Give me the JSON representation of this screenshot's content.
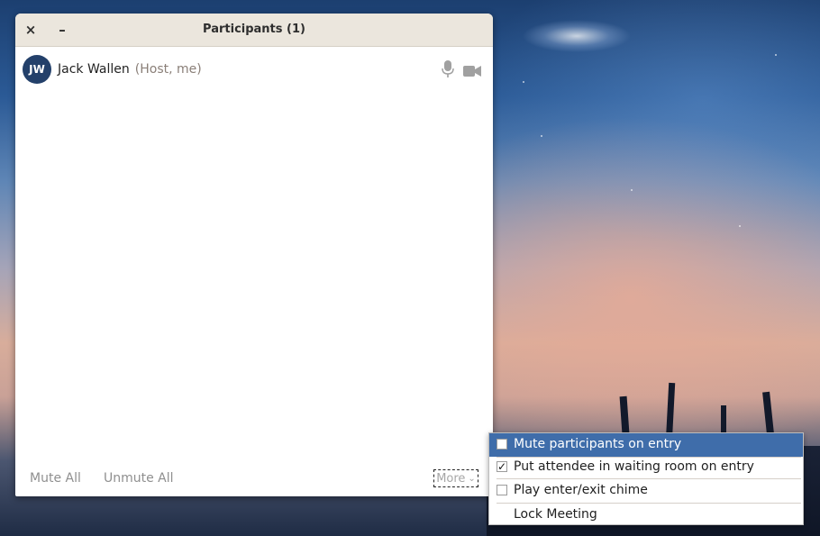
{
  "window": {
    "title": "Participants (1)",
    "close_glyph": "×",
    "minimize_glyph": "–"
  },
  "participant": {
    "initials": "JW",
    "name": "Jack Wallen",
    "role": "(Host, me)",
    "mic_icon": "microphone-icon",
    "camera_icon": "video-camera-icon"
  },
  "footer": {
    "mute_all": "Mute All",
    "unmute_all": "Unmute All",
    "more": "More",
    "more_chevron": "⌄"
  },
  "menu": {
    "items": [
      {
        "label": "Mute participants on entry",
        "checked": false,
        "highlighted": true,
        "check_glyph": ""
      },
      {
        "label": "Put attendee in waiting room on entry",
        "checked": true,
        "highlighted": false,
        "check_glyph": "✓"
      },
      {
        "label": "Play enter/exit chime",
        "checked": false,
        "highlighted": false,
        "check_glyph": ""
      },
      {
        "label": "Lock Meeting"
      }
    ]
  },
  "colors": {
    "avatar": "#23406a",
    "menu_highlight": "#3f6daa",
    "titlebar": "#ebe6dd",
    "muted_text": "#8f8f8f"
  }
}
